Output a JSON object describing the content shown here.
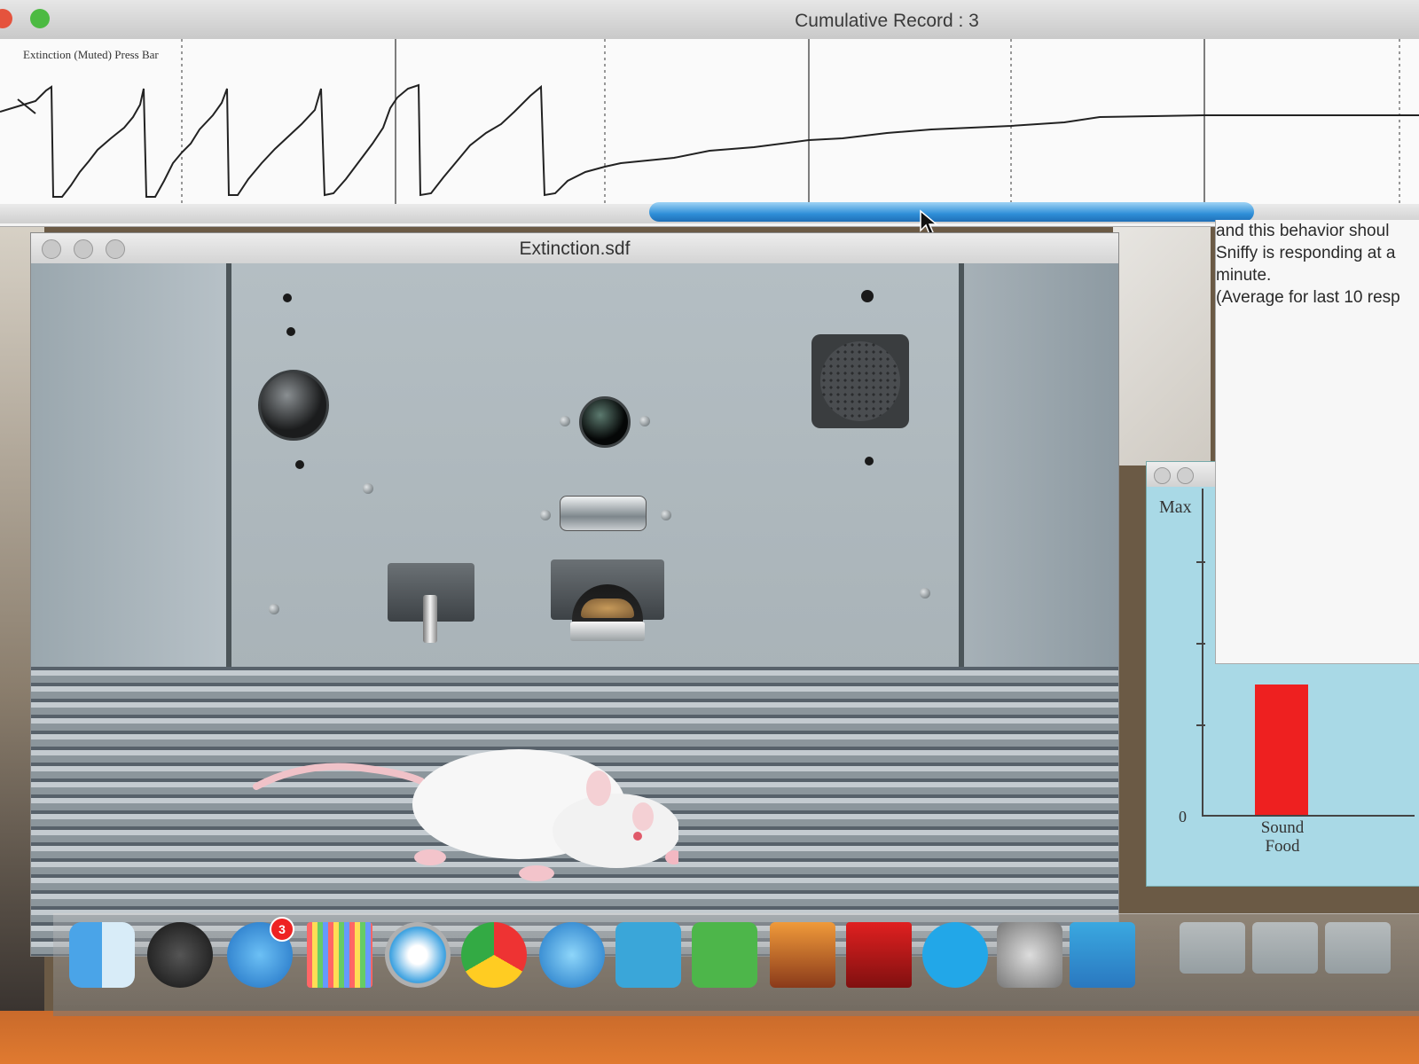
{
  "cumulative_record": {
    "title": "Cumulative Record : 3",
    "plot_label": "Extinction (Muted)  Press Bar"
  },
  "extinction_window": {
    "title": "Extinction.sdf"
  },
  "message_window": {
    "lines": [
      "and this behavior shoul",
      "Sniffy is responding at a",
      "minute.",
      "(Average for last 10 resp"
    ]
  },
  "response_strength": {
    "max_label": "Max",
    "zero_label": "0",
    "bar_label_line1": "Sound",
    "bar_label_line2": "Food",
    "bar_color": "#ee2020",
    "bar_fraction_of_max": 0.4
  },
  "dock": {
    "items": [
      {
        "name": "finder",
        "icon": "finder-icon"
      },
      {
        "name": "dashboard",
        "icon": "dashboard-icon"
      },
      {
        "name": "app-store",
        "icon": "app-store-icon",
        "badge": "3"
      },
      {
        "name": "launchpad-grid",
        "icon": "dot-grid-icon"
      },
      {
        "name": "safari",
        "icon": "safari-icon"
      },
      {
        "name": "chrome",
        "icon": "chrome-icon"
      },
      {
        "name": "itunes",
        "icon": "itunes-icon"
      },
      {
        "name": "word",
        "icon": "word-icon"
      },
      {
        "name": "excel",
        "icon": "excel-icon"
      },
      {
        "name": "iphoto",
        "icon": "iphoto-icon"
      },
      {
        "name": "photo-booth",
        "icon": "photo-booth-icon"
      },
      {
        "name": "skype",
        "icon": "skype-icon"
      },
      {
        "name": "system-preferences",
        "icon": "gear-icon"
      },
      {
        "name": "sniffy",
        "icon": "sniffy-rat-icon"
      }
    ]
  },
  "colors": {
    "scroll_thumb": "#2f8fd8",
    "traffic_close": "#e5533d",
    "traffic_zoom": "#4cba42"
  }
}
